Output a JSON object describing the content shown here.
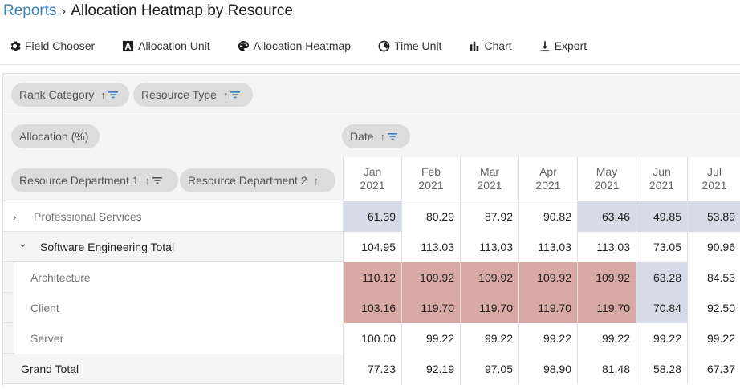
{
  "breadcrumb": {
    "parent": "Reports",
    "current": "Allocation Heatmap by Resource"
  },
  "toolbar": {
    "field_chooser": "Field Chooser",
    "allocation_unit": "Allocation Unit",
    "allocation_heatmap": "Allocation Heatmap",
    "time_unit": "Time Unit",
    "chart": "Chart",
    "export": "Export"
  },
  "filter_area": {
    "rank_category": "Rank Category",
    "resource_type": "Resource Type"
  },
  "data_area": {
    "allocation": "Allocation (%)"
  },
  "column_area": {
    "date": "Date"
  },
  "row_area": {
    "dept1": "Resource Department 1",
    "dept2": "Resource Department 2"
  },
  "columns": [
    {
      "month": "Jan",
      "year": "2021"
    },
    {
      "month": "Feb",
      "year": "2021"
    },
    {
      "month": "Mar",
      "year": "2021"
    },
    {
      "month": "Apr",
      "year": "2021"
    },
    {
      "month": "May",
      "year": "2021"
    },
    {
      "month": "Jun",
      "year": "2021"
    },
    {
      "month": "Jul",
      "year": "2021"
    }
  ],
  "rows": [
    {
      "label": "Professional Services",
      "values": [
        "61.39",
        "80.29",
        "87.92",
        "90.82",
        "63.46",
        "49.85",
        "53.89"
      ],
      "heat": [
        "low",
        "none",
        "none",
        "none",
        "low",
        "low",
        "low"
      ]
    },
    {
      "label": "Software Engineering Total",
      "values": [
        "104.95",
        "113.03",
        "113.03",
        "113.03",
        "113.03",
        "73.05",
        "90.96"
      ],
      "heat": [
        "none",
        "none",
        "none",
        "none",
        "none",
        "none",
        "none"
      ]
    },
    {
      "label": "Architecture",
      "values": [
        "110.12",
        "109.92",
        "109.92",
        "109.92",
        "109.92",
        "63.28",
        "84.53"
      ],
      "heat": [
        "high",
        "high",
        "high",
        "high",
        "high",
        "low",
        "none"
      ]
    },
    {
      "label": "Client",
      "values": [
        "103.16",
        "119.70",
        "119.70",
        "119.70",
        "119.70",
        "70.84",
        "92.50"
      ],
      "heat": [
        "high",
        "high",
        "high",
        "high",
        "high",
        "low",
        "none"
      ]
    },
    {
      "label": "Server",
      "values": [
        "100.00",
        "99.22",
        "99.22",
        "99.22",
        "99.22",
        "99.22",
        "99.22"
      ],
      "heat": [
        "none",
        "none",
        "none",
        "none",
        "none",
        "none",
        "none"
      ]
    },
    {
      "label": "Grand Total",
      "values": [
        "77.23",
        "92.19",
        "97.05",
        "98.90",
        "81.48",
        "58.28",
        "67.37"
      ],
      "heat": [
        "none",
        "none",
        "none",
        "none",
        "none",
        "none",
        "none"
      ]
    }
  ],
  "colors": {
    "heat_high": "#d8a9a5",
    "heat_low": "#d5dce7",
    "accent": "#3a7fc1"
  }
}
